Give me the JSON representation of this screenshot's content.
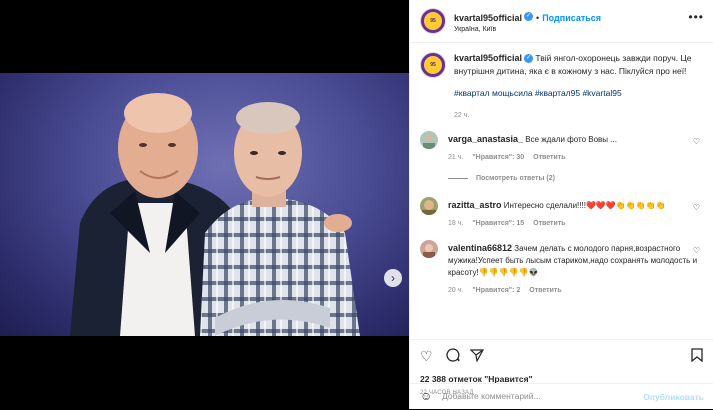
{
  "post": {
    "username": "kvartal95official",
    "verified_mark": "✓",
    "separator": "•",
    "subscribe_label": "Подписаться",
    "location": "Україна, Київ",
    "more_icon": "more-horizontal-icon"
  },
  "caption": {
    "username": "kvartal95official",
    "text": "Твій янгол-охоронець завжди поруч. Це внутрішня дитина, яка є в кожному з нас. Піклуйся про неї!",
    "hashtags": "#квартал мощьсила #квартал95 #kvartal95",
    "time": "22 ч."
  },
  "comments": [
    {
      "username": "varga_anastasia_",
      "text": "Все ждали фото Вовы ...",
      "time": "21 ч.",
      "likes": "\"Нравится\": 30",
      "reply": "Ответить"
    },
    {
      "username": "razitta_astro",
      "text": "Интересно сделали!!!!❤️❤️❤️👏👏👏👏👏",
      "time": "18 ч.",
      "likes": "\"Нравится\": 15",
      "reply": "Ответить"
    },
    {
      "username": "valentina66812",
      "text": "Зачем делать с молодого парня,возрастного мужика!Успеет быть лысым стариком,надо сохранять молодость и красоту!👎👎👎👎👎👽",
      "time": "20 ч.",
      "likes": "\"Нравится\": 2",
      "reply": "Ответить"
    }
  ],
  "view_replies": "Посмотреть ответы (2)",
  "likes_text": "22 388 отметок \"Нравится\"",
  "time_ago": "22 ЧАСОВ НАЗАД",
  "add_comment": {
    "placeholder": "Добавьте комментарий...",
    "publish_label": "Опубликовать"
  },
  "carousel": {
    "slides": 7,
    "active": 0
  },
  "colors": {
    "accent": "#0095f6",
    "verified": "#3897f0",
    "hashtag": "#00376b"
  }
}
